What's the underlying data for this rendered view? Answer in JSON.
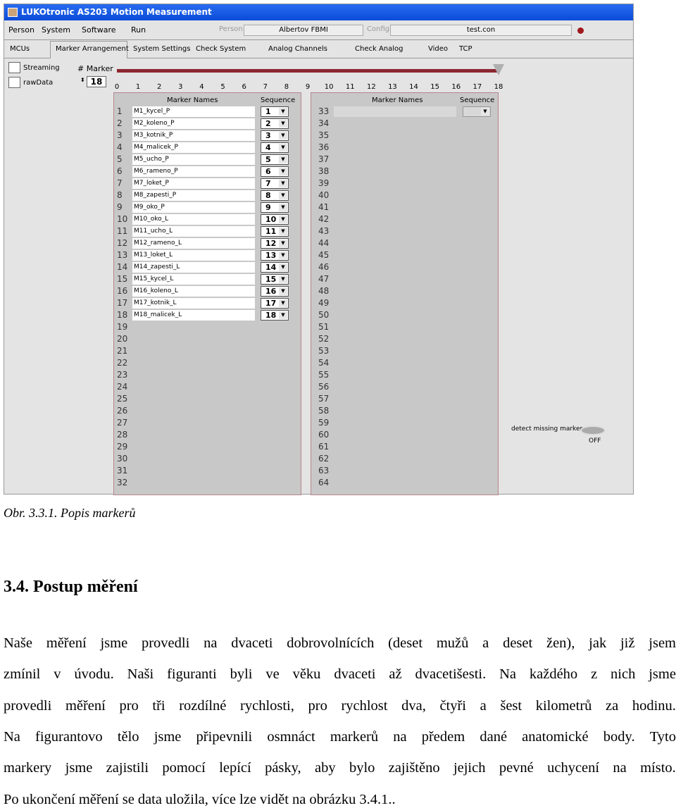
{
  "window": {
    "title": "LUKOtronic AS203 Motion Measurement",
    "menu": [
      "Person",
      "System",
      "Software",
      "Run"
    ],
    "person_label": "Person:",
    "person_value": "Albertov FBMI",
    "config_label": "Config:",
    "config_value": "test.con",
    "logo_text": "LUKOTRONIC",
    "tabs": [
      "MCUs",
      "Marker Arrangement",
      "System Settings",
      "Check System",
      "Analog Channels",
      "Check Analog",
      "Video",
      "TCP"
    ],
    "active_tab": "Marker Arrangement",
    "streaming_label": "Streaming",
    "rawdata_label": "rawData",
    "marker_count_label": "# Marker",
    "marker_count": "18",
    "slider": {
      "min": 0,
      "max": 18,
      "value": 18,
      "color": "#8c2730"
    },
    "col_names": "Marker Names",
    "col_sequence": "Sequence",
    "markers": [
      "M1_kycel_P",
      "M2_koleno_P",
      "M3_kotnik_P",
      "M4_malicek_P",
      "M5_ucho_P",
      "M6_rameno_P",
      "M7_loket_P",
      "M8_zapesti_P",
      "M9_oko_P",
      "M10_oko_L",
      "M11_ucho_L",
      "M12_rameno_L",
      "M13_loket_L",
      "M14_zapesti_L",
      "M15_kycel_L",
      "M16_koleno_L",
      "M17_kotnik_L",
      "M18_malicek_L"
    ],
    "detect_label": "detect missing marker",
    "detect_state": "OFF"
  },
  "caption": "Obr. 3.3.1. Popis markerů",
  "heading": "3.4. Postup měření",
  "paragraph_lines": [
    "Naše měření jsme provedli na dvaceti dobrovolnících (deset mužů a deset žen), jak již jsem",
    "zmínil v úvodu. Naši figuranti byli ve věku dvaceti až dvacetišesti. Na každého z nich jsme",
    "provedli měření pro tři rozdílné rychlosti, pro rychlost dva, čtyři a šest kilometrů za hodinu.",
    "Na figurantovo tělo jsme připevnili osmnáct markerů na předem dané anatomické body. Tyto",
    "markery jsme zajistili pomocí lepící pásky, aby bylo zajištěno jejich pevné uchycení na místo.",
    "Po ukončení měření se data uložila, více lze vidět na obrázku 3.4.1.."
  ]
}
